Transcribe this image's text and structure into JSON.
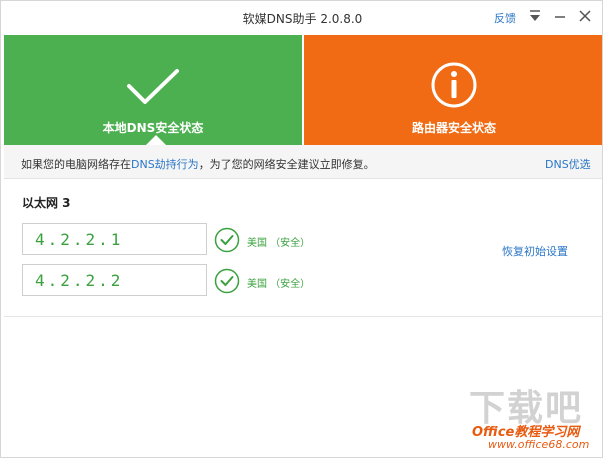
{
  "titlebar": {
    "title": "软媒DNS助手 2.0.8.0",
    "feedback": "反馈",
    "icons": [
      "menu-triangle-icon",
      "minimize-icon",
      "close-icon"
    ]
  },
  "panels": {
    "local": {
      "label": "本地DNS安全状态",
      "icon": "check-icon",
      "color": "#4caf50",
      "selected": true
    },
    "router": {
      "label": "路由器安全状态",
      "icon": "info-icon",
      "color": "#f06b13"
    }
  },
  "infobar": {
    "text_before": "如果您的电脑网络存在",
    "link": "DNS劫持行为",
    "text_after": "，为了您的网络安全建议立即修复。",
    "dns_optimize": "DNS优选"
  },
  "network": {
    "name": "以太网 3",
    "dns": [
      {
        "value": "4.2.2.1",
        "status": "美国 （安全）"
      },
      {
        "value": "4.2.2.2",
        "status": "美国 （安全）"
      }
    ],
    "restore": "恢复初始设置"
  },
  "watermark": {
    "big": "下载吧",
    "line1": "Office教程学习网",
    "line2": "www.office68.com"
  },
  "colors": {
    "accent": "#2a76c6",
    "ok": "#3aa13e",
    "green": "#4caf50",
    "orange": "#f06b13"
  }
}
